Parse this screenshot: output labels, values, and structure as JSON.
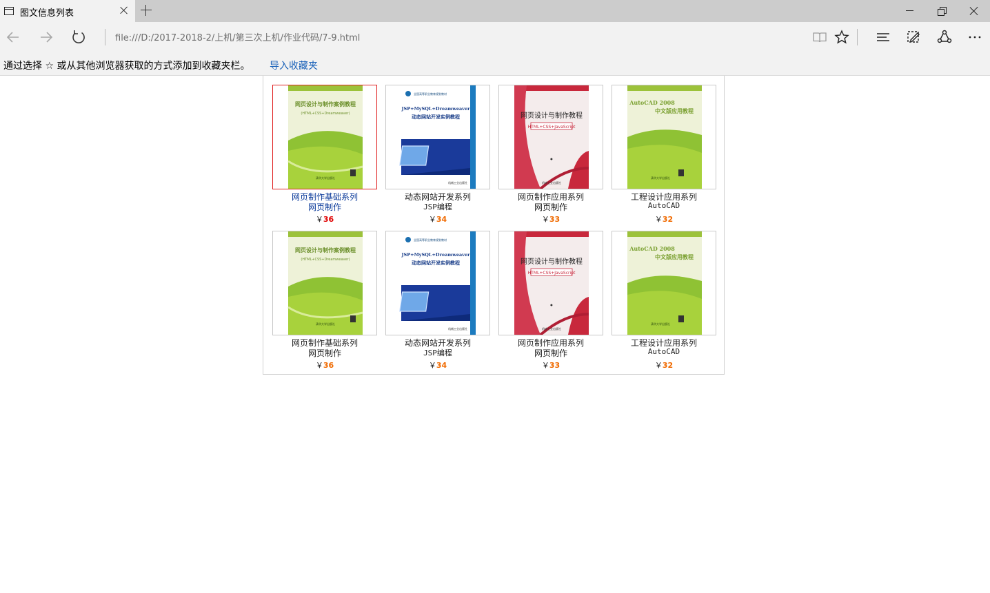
{
  "browser": {
    "tab_title": "图文信息列表",
    "address": "file:///D:/2017-2018-2/上机/第三次上机/作业代码/7-9.html"
  },
  "favorites_bar": {
    "message": "通过选择 ☆ 或从其他浏览器获取的方式添加到收藏夹栏。",
    "import_link": "导入收藏夹"
  },
  "products": [
    {
      "title": "网页制作基础系列",
      "subtitle": "网页制作",
      "currency": "￥",
      "price": "36",
      "cover": "green-web",
      "selected": true
    },
    {
      "title": "动态网站开发系列",
      "subtitle": "JSP编程",
      "currency": "￥",
      "price": "34",
      "cover": "blue-jsp",
      "selected": false
    },
    {
      "title": "网页制作应用系列",
      "subtitle": "网页制作",
      "currency": "￥",
      "price": "33",
      "cover": "red-web",
      "selected": false
    },
    {
      "title": "工程设计应用系列",
      "subtitle": "AutoCAD",
      "currency": "￥",
      "price": "32",
      "cover": "green-cad",
      "selected": false
    },
    {
      "title": "网页制作基础系列",
      "subtitle": "网页制作",
      "currency": "￥",
      "price": "36",
      "cover": "green-web",
      "selected": false
    },
    {
      "title": "动态网站开发系列",
      "subtitle": "JSP编程",
      "currency": "￥",
      "price": "34",
      "cover": "blue-jsp",
      "selected": false
    },
    {
      "title": "网页制作应用系列",
      "subtitle": "网页制作",
      "currency": "￥",
      "price": "33",
      "cover": "red-web",
      "selected": false
    },
    {
      "title": "工程设计应用系列",
      "subtitle": "AutoCAD",
      "currency": "￥",
      "price": "32",
      "cover": "green-cad",
      "selected": false
    }
  ],
  "covers": {
    "green-web": {
      "line1": "网页设计与制作案例教程",
      "line2": "(HTML+CSS+Dreamweaver)",
      "publisher": "清华大学出版社"
    },
    "blue-jsp": {
      "line1": "JSP+MySQL+Dreamweaver",
      "line2": "动态网站开发实例教程",
      "series": "全国高等职业教育规划教材",
      "publisher": "机械工业出版社"
    },
    "red-web": {
      "line1": "网页设计与制作教程",
      "line2": "HTML+CSS+JavaScript",
      "publisher": "机械工业出版社"
    },
    "green-cad": {
      "line1": "AutoCAD 2008",
      "line2": "中文版应用教程",
      "publisher": "清华大学出版社"
    }
  },
  "colors": {
    "selected_border": "#e02020",
    "price_normal": "#f06a00",
    "price_selected": "#e00000",
    "link": "#1a62b9"
  }
}
